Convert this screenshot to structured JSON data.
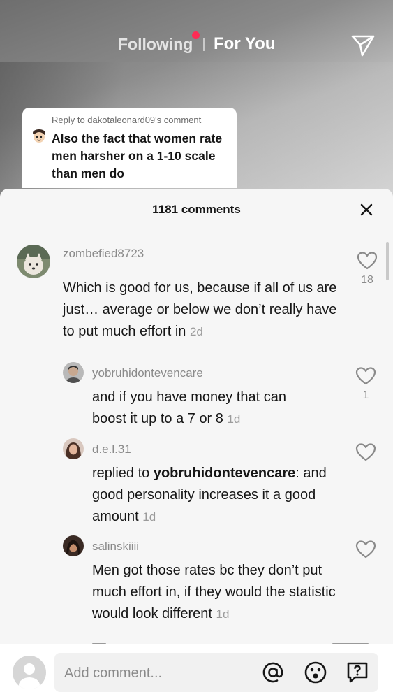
{
  "nav": {
    "following_label": "Following",
    "for_you_label": "For You",
    "notification_dot_color": "#fe2c55"
  },
  "reply_card": {
    "reply_to": "Reply to dakotaleonard09's comment",
    "text": "Also the fact that women rate men harsher on a 1-10 scale than men do"
  },
  "sheet": {
    "title": "1181 comments"
  },
  "comments": [
    {
      "username": "zombefied8723",
      "text": "Which is good for us, because if all of us are just… average or below we don’t really have to put much effort in",
      "time": "2d",
      "likes": "18"
    },
    {
      "username": "yobruhidontevencare",
      "text": "and if you have money that can boost it up to a 7 or 8",
      "time": "1d",
      "likes": "1"
    },
    {
      "username": "d.e.l.31",
      "replied_prefix": "replied to",
      "replied_to": "yobruhidontevencare",
      "text": "and good personality increases it a good amount",
      "time": "1d"
    },
    {
      "username": "salinskiiii",
      "text": "Men got those rates bc they don’t put much effort in, if they would the statistic would look different",
      "time": "1d"
    }
  ],
  "bottom": {
    "placeholder": "Add comment..."
  }
}
